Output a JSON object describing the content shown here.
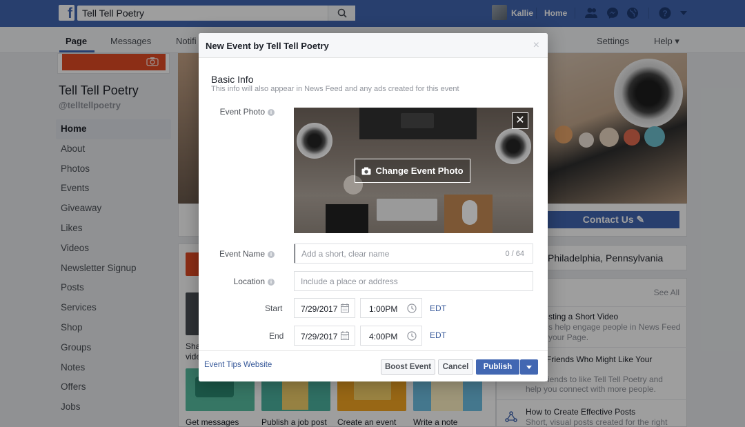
{
  "topbar": {
    "search_value": "Tell Tell Poetry",
    "user_name": "Kallie",
    "home_label": "Home"
  },
  "page_nav": {
    "tabs": [
      {
        "label": "Page"
      },
      {
        "label": "Messages"
      },
      {
        "label": "Notifi"
      }
    ],
    "settings_label": "Settings",
    "help_label": "Help ▾"
  },
  "page": {
    "name": "Tell Tell Poetry",
    "handle": "@telltellpoetry",
    "nav": [
      {
        "label": "Home"
      },
      {
        "label": "About"
      },
      {
        "label": "Photos"
      },
      {
        "label": "Events"
      },
      {
        "label": "Giveaway"
      },
      {
        "label": "Likes"
      },
      {
        "label": "Videos"
      },
      {
        "label": "Newsletter Signup"
      },
      {
        "label": "Posts"
      },
      {
        "label": "Services"
      },
      {
        "label": "Shop"
      },
      {
        "label": "Groups"
      },
      {
        "label": "Notes"
      },
      {
        "label": "Offers"
      },
      {
        "label": "Jobs"
      }
    ]
  },
  "right": {
    "contact_label": "Contact Us",
    "location": "Philadelphia, Pennsylvania",
    "see_all": "See All",
    "tips": [
      {
        "title": "sting a Short Video",
        "desc1": "s help engage people in News Feed",
        "desc2": "your Page."
      },
      {
        "title": "Friends Who Might Like Your",
        "desc1": "riends to like Tell Tell Poetry and",
        "desc2": "help you connect with more people."
      },
      {
        "title": "How to Create Effective Posts",
        "desc1": "Short, visual posts created for the right",
        "desc2": ""
      }
    ]
  },
  "center": {
    "partial_text_1": "Sha",
    "partial_text_2": "vide",
    "actions": [
      {
        "label": "Get messages"
      },
      {
        "label": "Publish a job post"
      },
      {
        "label": "Create an event"
      },
      {
        "label": "Write a note"
      }
    ]
  },
  "modal": {
    "title": "New Event by Tell Tell Poetry",
    "close": "×",
    "section_title": "Basic Info",
    "section_sub": "This info will also appear in News Feed and any ads created for this event",
    "photo_label": "Event Photo",
    "change_photo_label": "Change Event Photo",
    "photo_remove": "✕",
    "name_label": "Event Name",
    "name_placeholder": "Add a short, clear name",
    "name_counter": "0 / 64",
    "location_label": "Location",
    "location_placeholder": "Include a place or address",
    "start_label": "Start",
    "start_date": "7/29/2017",
    "start_time": "1:00PM",
    "end_label": "End",
    "end_date": "7/29/2017",
    "end_time": "4:00PM",
    "timezone": "EDT",
    "info_glyph": "i",
    "footer": {
      "tips_link": "Event Tips Website",
      "boost_label": "Boost Event",
      "cancel_label": "Cancel",
      "publish_label": "Publish"
    }
  },
  "colors": {
    "brand_blue": "#4267b2",
    "link_blue": "#365899",
    "cover_red": "#e24b25"
  }
}
